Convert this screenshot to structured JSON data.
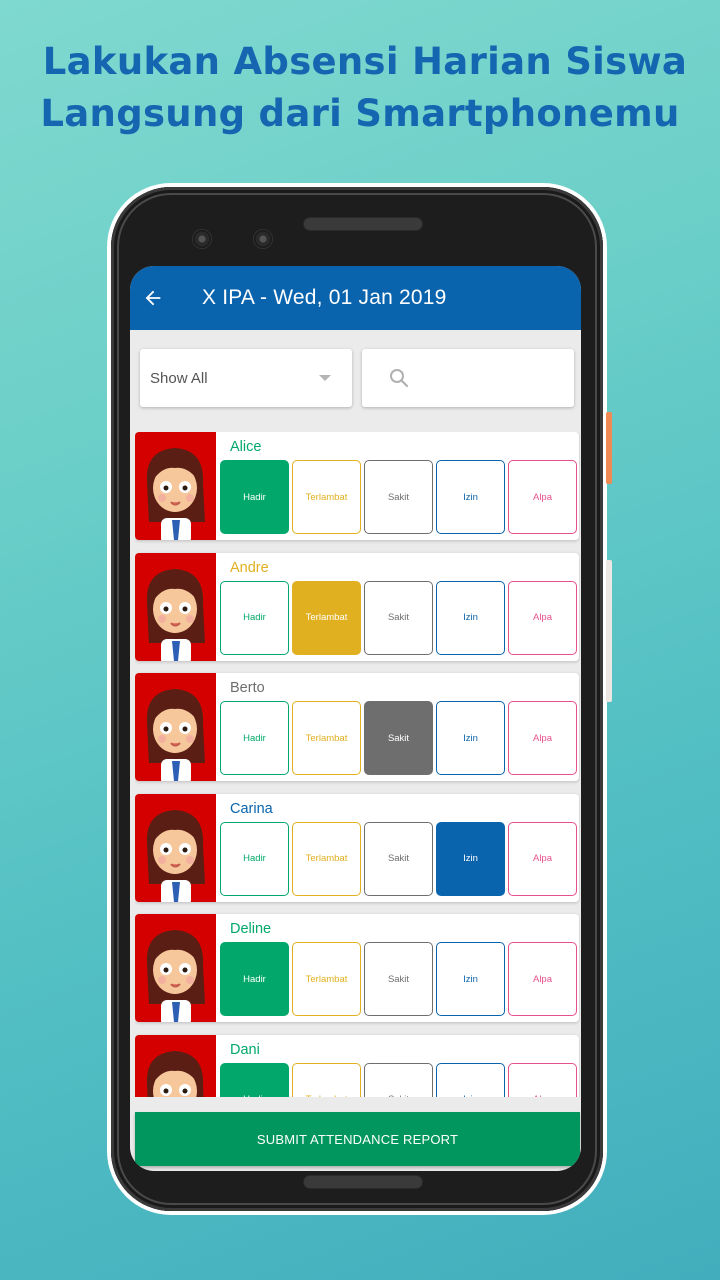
{
  "promo": {
    "line1": "Lakukan Absensi Harian Siswa",
    "line2": "Langsung dari Smartphonemu"
  },
  "appbar": {
    "back_icon": "arrow-left-icon",
    "title": "X IPA - Wed, 01 Jan 2019"
  },
  "filters": {
    "dropdown_value": "Show All",
    "dropdown_icon": "caret-down-icon",
    "search_placeholder": "",
    "search_icon": "search-icon"
  },
  "status_options": [
    {
      "key": "hadir",
      "label": "Hadir",
      "color": "#02a86b"
    },
    {
      "key": "terlambat",
      "label": "Terlambat",
      "color": "#e0b020"
    },
    {
      "key": "sakit",
      "label": "Sakit",
      "color": "#6e6e6e"
    },
    {
      "key": "izin",
      "label": "Izin",
      "color": "#0a64ad"
    },
    {
      "key": "alpa",
      "label": "Alpa",
      "color": "#e8508c"
    }
  ],
  "students": [
    {
      "name": "Alice",
      "status": "hadir",
      "avatar": "girl-waving"
    },
    {
      "name": "Andre",
      "status": "terlambat",
      "avatar": "boy-curly-hair"
    },
    {
      "name": "Berto",
      "status": "sakit",
      "avatar": "boy-waving"
    },
    {
      "name": "Carina",
      "status": "izin",
      "avatar": "girl-backpack"
    },
    {
      "name": "Deline",
      "status": "hadir",
      "avatar": "girl-pigtails"
    },
    {
      "name": "Dani",
      "status": "hadir",
      "avatar": "boy-smiling"
    }
  ],
  "submit_label": "SUBMIT ATTENDANCE REPORT",
  "colors": {
    "primary": "#0a64ad",
    "submit": "#02965f",
    "avatar_bg": "#d40000",
    "promo_text": "#1466b0"
  }
}
